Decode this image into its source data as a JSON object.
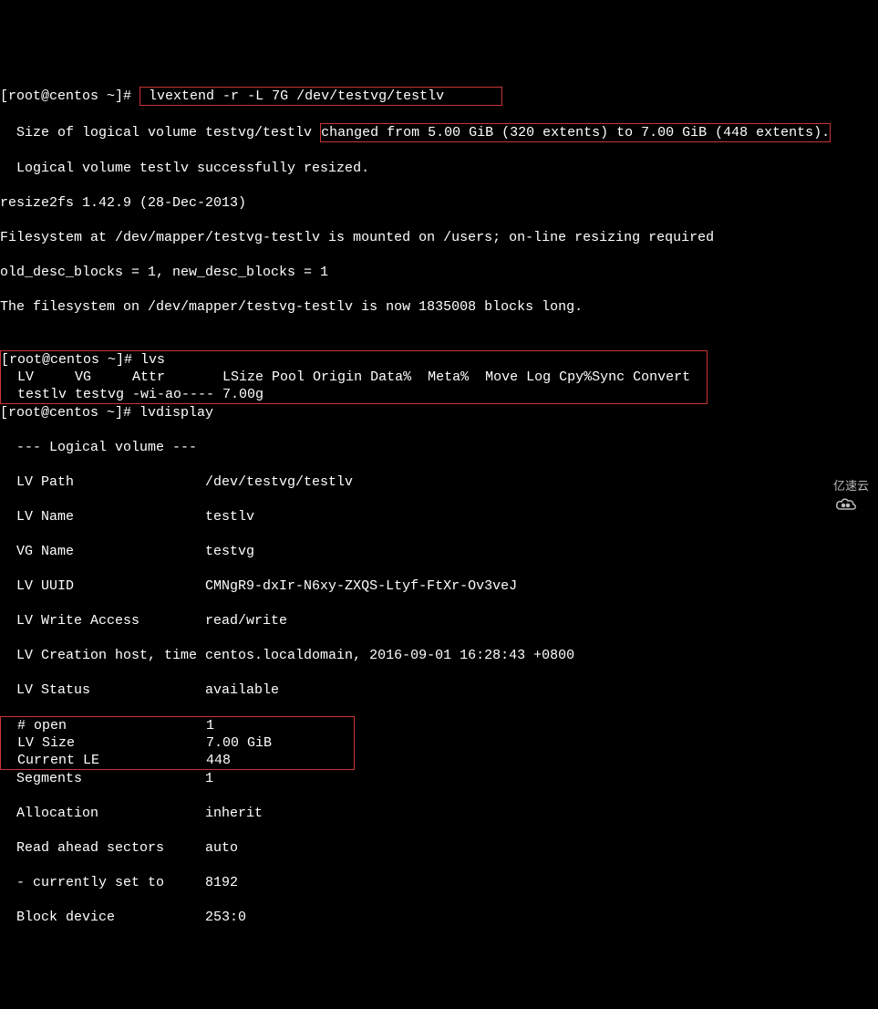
{
  "line0": " ------  ..  -- -.-.",
  "prompt": "[root@centos ~]# ",
  "cmd1": "lvextend -r -L 7G /dev/testvg/testlv",
  "out1a": "  Size of logical volume testvg/testlv ",
  "out1b": "changed from 5.00 GiB (320 extents) to 7.00 GiB (448 extents).",
  "out2": "  Logical volume testlv successfully resized.",
  "out3": "resize2fs 1.42.9 (28-Dec-2013)",
  "out4": "Filesystem at /dev/mapper/testvg-testlv is mounted on /users; on-line resizing required",
  "out5": "old_desc_blocks = 1, new_desc_blocks = 1",
  "out6": "The filesystem on /dev/mapper/testvg-testlv is now 1835008 blocks long.",
  "blank": "",
  "cmd2": "lvs",
  "lvs_header": "  LV     VG     Attr       LSize Pool Origin Data%  Meta%  Move Log Cpy%Sync Convert",
  "lvs_row": "  testlv testvg -wi-ao---- 7.00g                                                      ",
  "cmd3": "lvdisplay",
  "lvd1": "  --- Logical volume ---",
  "lvd2": "  LV Path                /dev/testvg/testlv",
  "lvd3": "  LV Name                testlv",
  "lvd4": "  VG Name                testvg",
  "lvd5": "  LV UUID                CMNgR9-dxIr-N6xy-ZXQS-Ltyf-FtXr-Ov3veJ",
  "lvd6": "  LV Write Access        read/write",
  "lvd7": "  LV Creation host, time centos.localdomain, 2016-09-01 16:28:43 +0800",
  "lvd8": "  LV Status              available",
  "lvd9a": "  # open                 1                 ",
  "lvd9b": "  LV Size                7.00 GiB          ",
  "lvd9c": "  Current LE             448               ",
  "lvd10": "  Segments               1",
  "lvd11": "  Allocation             inherit",
  "lvd12": "  Read ahead sectors     auto",
  "lvd13": "  - currently set to     8192",
  "lvd14": "  Block device           253:0",
  "logo_text": "亿速云"
}
